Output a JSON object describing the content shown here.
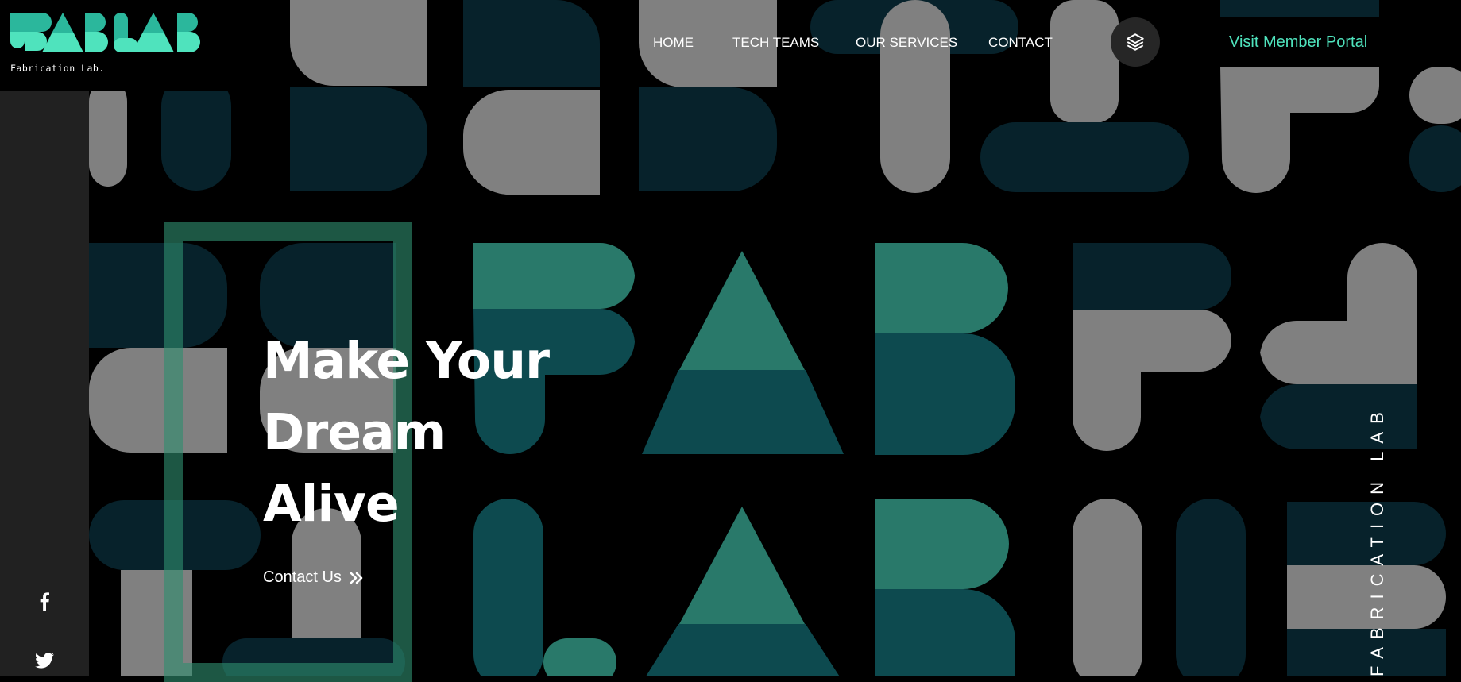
{
  "brand": {
    "logo_text": "FABLAB",
    "tagline": "Fabrication Lab."
  },
  "nav": {
    "items": [
      {
        "label": "HOME"
      },
      {
        "label": "TECH TEAMS"
      },
      {
        "label": "OUR SERVICES"
      },
      {
        "label": "CONTACT"
      }
    ],
    "layers_icon": "layers-icon",
    "portal_label": "Visit Member Portal"
  },
  "hero": {
    "title_lines": [
      "Make Your",
      "Dream",
      "Alive"
    ],
    "cta_label": "Contact Us",
    "cta_icon": "double-chevron-right-icon",
    "vertical_text": "FABRICATION LAB"
  },
  "social": [
    {
      "name": "facebook-icon"
    },
    {
      "name": "twitter-icon"
    }
  ],
  "colors": {
    "accent": "#4fe3bd",
    "teal_dark": "#07222b",
    "teal_mid": "#0d4a4f",
    "teal_green": "#29796a",
    "gray_shape": "#808080",
    "sidebar": "#212121"
  }
}
